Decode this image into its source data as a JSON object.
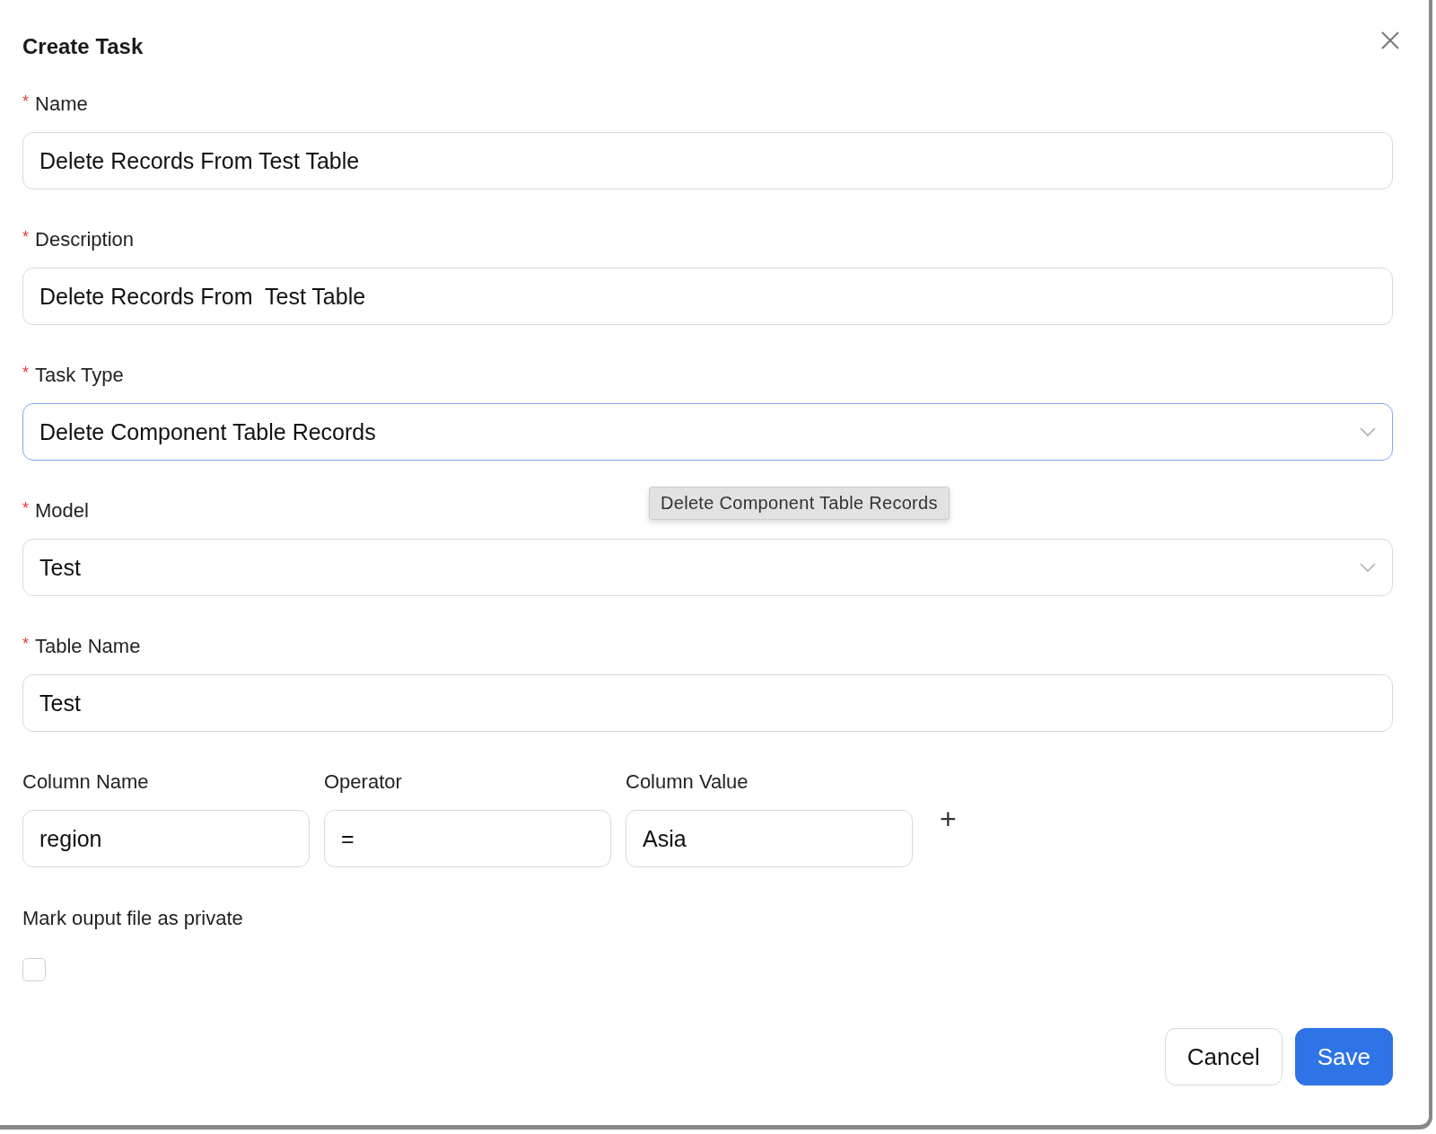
{
  "dialog": {
    "title": "Create Task"
  },
  "fields": [
    {
      "label": "Name",
      "required_mark": "*",
      "kind": "text",
      "value": "Delete Records From Test Table",
      "focused": false
    },
    {
      "label": "Description",
      "required_mark": "*",
      "kind": "text",
      "value": "Delete Records From  Test Table",
      "focused": false
    },
    {
      "label": "Task Type",
      "required_mark": "*",
      "kind": "select",
      "value": "Delete Component Table Records",
      "focused": true
    },
    {
      "label": "Model",
      "required_mark": "*",
      "kind": "select",
      "value": "Test",
      "focused": false
    },
    {
      "label": "Table Name",
      "required_mark": "*",
      "kind": "text",
      "value": "Test",
      "focused": false
    }
  ],
  "tooltip": {
    "text": "Delete Component Table Records"
  },
  "condition_columns": [
    {
      "label": "Column Name",
      "value": "region"
    },
    {
      "label": "Operator",
      "value": "="
    },
    {
      "label": "Column Value",
      "value": "Asia"
    }
  ],
  "add_condition": {
    "symbol": "+"
  },
  "private_option": {
    "label": "Mark ouput file as private",
    "checked": false
  },
  "buttons": [
    {
      "label": "Cancel",
      "kind": "secondary"
    },
    {
      "label": "Save",
      "kind": "primary"
    }
  ]
}
